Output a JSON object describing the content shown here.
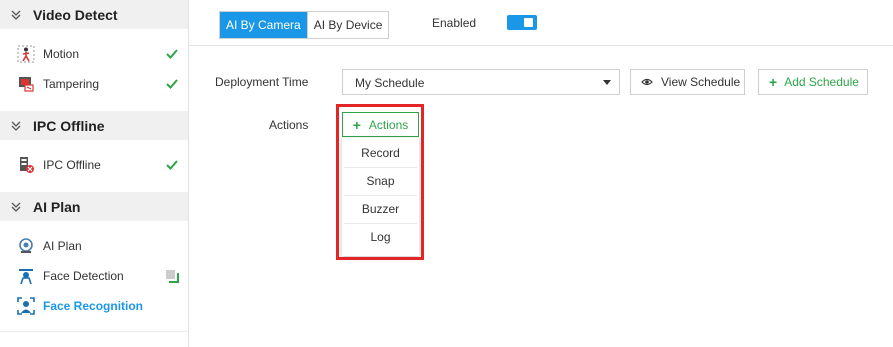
{
  "sidebar": {
    "groups": [
      {
        "title": "Video Detect",
        "icon": "chevron-double-down-icon"
      },
      {
        "title": "IPC Offline",
        "icon": "chevron-double-down-icon"
      },
      {
        "title": "AI Plan",
        "icon": "chevron-double-down-icon"
      }
    ],
    "items": [
      {
        "label": "Motion",
        "icon": "motion-icon",
        "status": "enabled"
      },
      {
        "label": "Tampering",
        "icon": "tampering-icon",
        "status": "enabled"
      },
      {
        "label": "IPC Offline",
        "icon": "ipc-offline-icon",
        "status": "enabled"
      },
      {
        "label": "AI Plan",
        "icon": "ai-plan-icon"
      },
      {
        "label": "Face Detection",
        "icon": "face-detection-icon",
        "status": "partial"
      },
      {
        "label": "Face Recognition",
        "icon": "face-recognition-icon",
        "active": true
      }
    ]
  },
  "main": {
    "tabs": [
      {
        "label": "AI By Camera",
        "active": true
      },
      {
        "label": "AI By Device",
        "active": false
      }
    ],
    "enabled_label": "Enabled",
    "enabled": true,
    "deployment_time_label": "Deployment Time",
    "schedule_value": "My Schedule",
    "view_schedule_label": "View Schedule",
    "add_schedule_label": "Add Schedule",
    "actions_label": "Actions",
    "actions_button_label": "Actions",
    "actions_menu": [
      "Record",
      "Snap",
      "Buzzer",
      "Log"
    ]
  },
  "colors": {
    "accent": "#1a97e6",
    "success": "#2ea44a",
    "highlight": "#e32525"
  }
}
